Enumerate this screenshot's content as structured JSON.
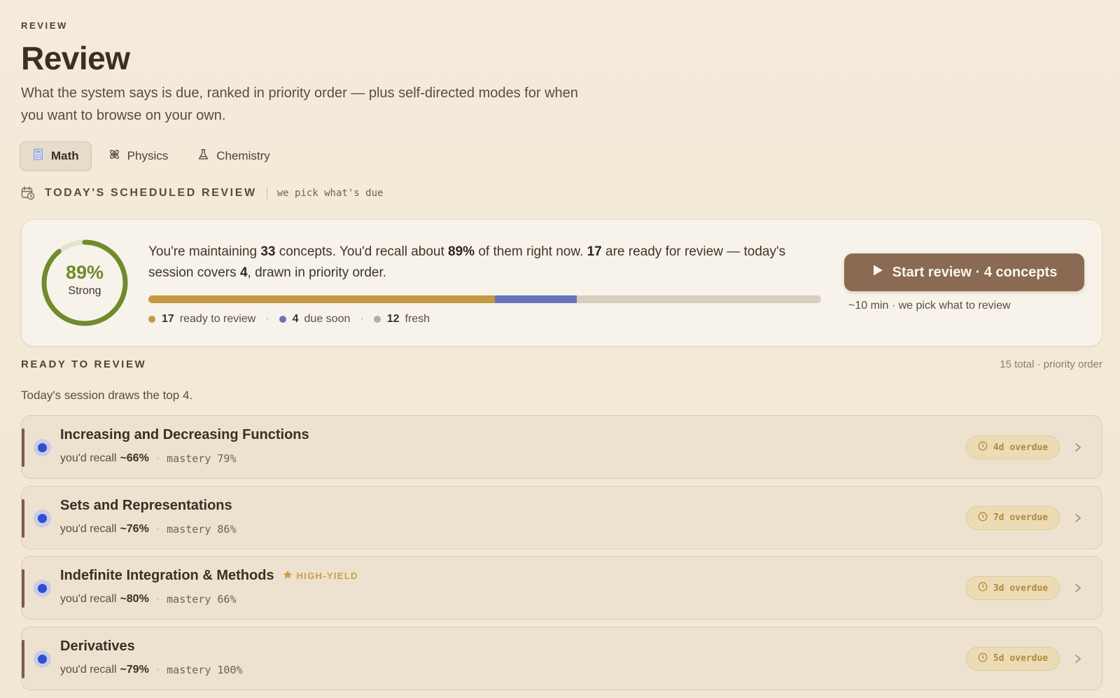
{
  "header": {
    "eyebrow": "REVIEW",
    "title": "Review",
    "subtitle": "What the system says is due, ranked in priority order — plus self-directed modes for when you want to browse on your own."
  },
  "tabs": [
    {
      "label": "Math",
      "icon": "calculator-icon",
      "active": true
    },
    {
      "label": "Physics",
      "icon": "atom-icon",
      "active": false
    },
    {
      "label": "Chemistry",
      "icon": "flask-icon",
      "active": false
    }
  ],
  "scheduled": {
    "title": "TODAY'S SCHEDULED REVIEW",
    "note": "we pick what's due",
    "ring": {
      "percent_label": "89%",
      "status": "Strong",
      "fraction": 0.89,
      "color": "#6f8b2c"
    },
    "summary": {
      "t1": "You're maintaining ",
      "concepts": "33",
      "t2": " concepts. You'd recall about ",
      "recall": "89%",
      "t3": " of them right now. ",
      "ready": "17",
      "t4": " are ready for review — today's session covers ",
      "covers": "4",
      "t5": ", drawn in priority order."
    },
    "progress": [
      {
        "fraction": 0.5155,
        "color": "#c29a42"
      },
      {
        "fraction": 0.1215,
        "color": "#6872bd"
      }
    ],
    "legend": [
      {
        "count": "17",
        "label": "ready to review",
        "color": "#c29a42"
      },
      {
        "count": "4",
        "label": "due soon",
        "color": "#6872bd"
      },
      {
        "count": "12",
        "label": "fresh",
        "color": "#b7ad9f"
      }
    ],
    "start_button": "Start review · 4 concepts",
    "start_hint": "~10 min · we pick what to review"
  },
  "ready": {
    "title": "READY TO REVIEW",
    "meta": "15 total · priority order",
    "subtitle": "Today's session draws the top 4.",
    "items": [
      {
        "name": "Increasing and Decreasing Functions",
        "recall_prefix": "you'd recall",
        "recall": "~66%",
        "mastery": "mastery 79%",
        "overdue": "4d overdue",
        "badge": ""
      },
      {
        "name": "Sets and Representations",
        "recall_prefix": "you'd recall",
        "recall": "~76%",
        "mastery": "mastery 86%",
        "overdue": "7d overdue",
        "badge": ""
      },
      {
        "name": "Indefinite Integration & Methods",
        "recall_prefix": "you'd recall",
        "recall": "~80%",
        "mastery": "mastery 66%",
        "overdue": "3d overdue",
        "badge": "HIGH-YIELD"
      },
      {
        "name": "Derivatives",
        "recall_prefix": "you'd recall",
        "recall": "~79%",
        "mastery": "mastery 100%",
        "overdue": "5d overdue",
        "badge": ""
      }
    ]
  }
}
